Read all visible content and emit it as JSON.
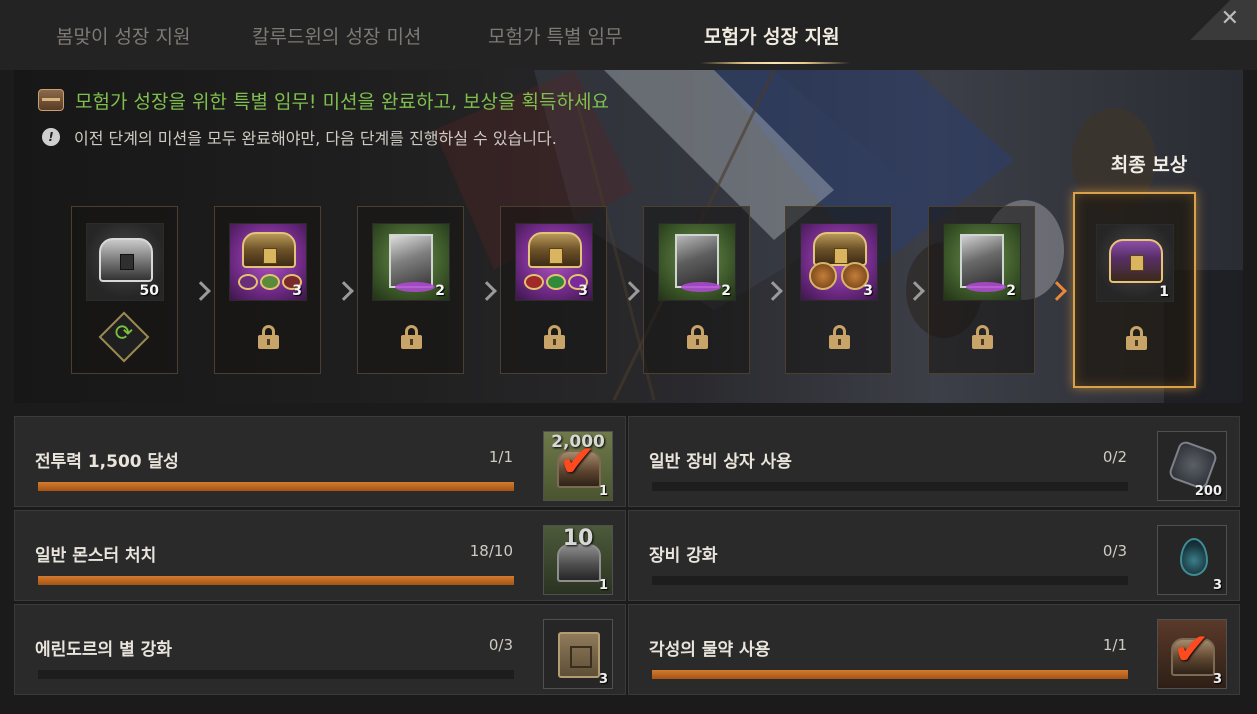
{
  "tabs": [
    {
      "label": "봄맞이 성장 지원",
      "active": false
    },
    {
      "label": "칼루드윈의 성장 미션",
      "active": false
    },
    {
      "label": "모험가 특별 임무",
      "active": false
    },
    {
      "label": "모험가 성장 지원",
      "active": true
    }
  ],
  "close_icon": "✕",
  "banner": {
    "notice": "모험가 성장을 위한 특별 임무! 미션을 완료하고, 보상을 획득하세요",
    "info": "이전 단계의 미션을 모두 완료해야만, 다음 단계를 진행하실 수 있습니다.",
    "info_icon": "!",
    "final_reward_label": "최종 보상"
  },
  "stages": [
    {
      "qty": "50",
      "status": "repeat",
      "icon": "silver-chest-icon"
    },
    {
      "qty": "3",
      "status": "locked",
      "icon": "gem-chest-icon"
    },
    {
      "qty": "2",
      "status": "locked",
      "icon": "cube-icon"
    },
    {
      "qty": "3",
      "status": "locked",
      "icon": "gem-chest-icon"
    },
    {
      "qty": "2",
      "status": "locked",
      "icon": "cube-icon"
    },
    {
      "qty": "3",
      "status": "locked",
      "icon": "coin-icon"
    },
    {
      "qty": "2",
      "status": "locked",
      "icon": "cube-icon"
    },
    {
      "qty": "1",
      "status": "locked",
      "icon": "gold-chest-icon"
    }
  ],
  "missions": [
    {
      "title": "전투력 1,500 달성",
      "count": "1/1",
      "progress": 1.0,
      "reward_qty": "1",
      "reward_top": "2,000",
      "reward_icon": "chest-check-icon",
      "done": true
    },
    {
      "title": "일반 장비 상자 사용",
      "count": "0/2",
      "progress": 0.0,
      "reward_qty": "200",
      "reward_top": "",
      "reward_icon": "stone-icon",
      "done": false
    },
    {
      "title": "일반 몬스터 처치",
      "count": "18/10",
      "progress": 1.0,
      "reward_qty": "1",
      "reward_top": "10",
      "reward_icon": "chest-icon",
      "done": false
    },
    {
      "title": "장비 강화",
      "count": "0/3",
      "progress": 0.0,
      "reward_qty": "3",
      "reward_top": "",
      "reward_icon": "drop-icon",
      "done": false
    },
    {
      "title": "에린도르의 별 강화",
      "count": "0/3",
      "progress": 0.0,
      "reward_qty": "3",
      "reward_top": "",
      "reward_icon": "scroll-icon",
      "done": false
    },
    {
      "title": "각성의 물약 사용",
      "count": "1/1",
      "progress": 1.0,
      "reward_qty": "3",
      "reward_top": "",
      "reward_icon": "chest-check-icon",
      "done": true
    }
  ],
  "check_glyph": "✔",
  "colors": {
    "accent_orange": "#d37a2e",
    "notice_green": "#7fbf4d",
    "frame_gold": "#d9a24a"
  }
}
